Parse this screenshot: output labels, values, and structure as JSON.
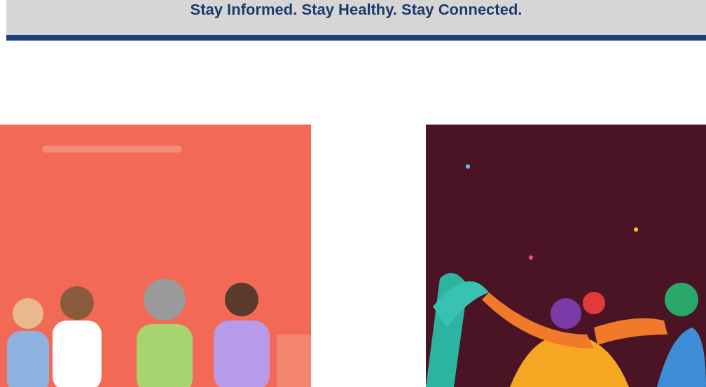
{
  "banner": {
    "tagline": "Stay Informed. Stay Healthy. Stay Connected."
  }
}
